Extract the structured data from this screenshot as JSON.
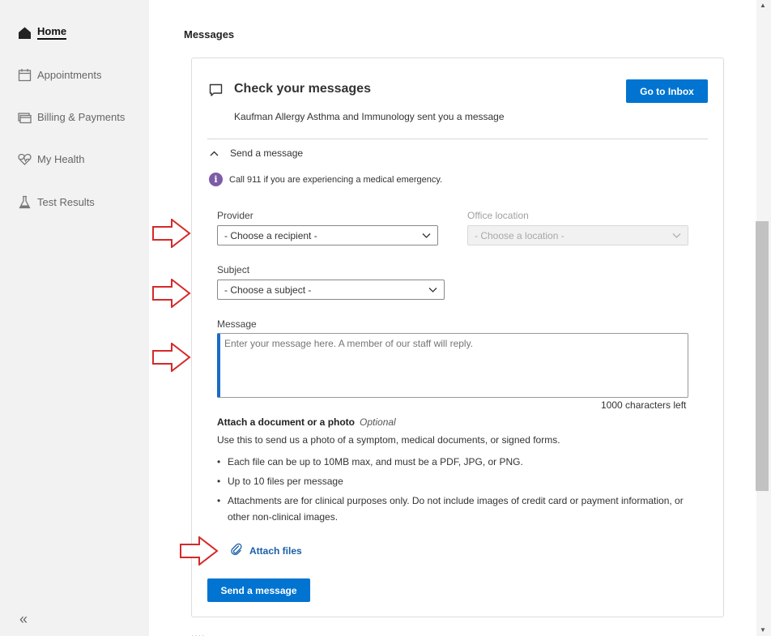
{
  "sidebar": {
    "items": [
      {
        "label": "Home",
        "icon": "home-icon"
      },
      {
        "label": "Appointments",
        "icon": "calendar-icon"
      },
      {
        "label": "Billing & Payments",
        "icon": "credit-card-icon"
      },
      {
        "label": "My Health",
        "icon": "heart-pulse-icon"
      },
      {
        "label": "Test Results",
        "icon": "flask-icon"
      }
    ],
    "collapse_glyph": "«"
  },
  "main": {
    "section_title": "Messages",
    "card": {
      "title": "Check your messages",
      "inbox_button": "Go to Inbox",
      "subtext": "Kaufman Allergy Asthma and Immunology sent you a message",
      "expander_label": "Send a message",
      "emergency_note": "Call 911 if you are experiencing a medical emergency.",
      "provider": {
        "label": "Provider",
        "value": "- Choose a recipient -"
      },
      "office_location": {
        "label": "Office location",
        "value": "- Choose a location -"
      },
      "subject": {
        "label": "Subject",
        "value": "- Choose a subject -"
      },
      "message": {
        "label": "Message",
        "placeholder": "Enter your message here. A member of our staff will reply.",
        "chars_left": "1000 characters left"
      },
      "attach": {
        "title": "Attach a document or a photo",
        "optional": "Optional",
        "description": "Use this to send us a photo of a symptom, medical documents, or signed forms.",
        "bullets": [
          "Each file can be up to 10MB max, and must be a PDF, JPG, or PNG.",
          "Up to 10 files per message",
          "Attachments are for clinical purposes only. Do not include images of credit card or payment information, or other non-clinical images."
        ],
        "link": "Attach files"
      },
      "send_button": "Send a message"
    },
    "more_indicator": "...."
  },
  "colors": {
    "primary": "#0074d0",
    "link": "#1a5fa8",
    "info": "#7d5ba6",
    "annotation_arrow": "#d42a2a",
    "sidebar_bg": "#f2f2f2"
  }
}
